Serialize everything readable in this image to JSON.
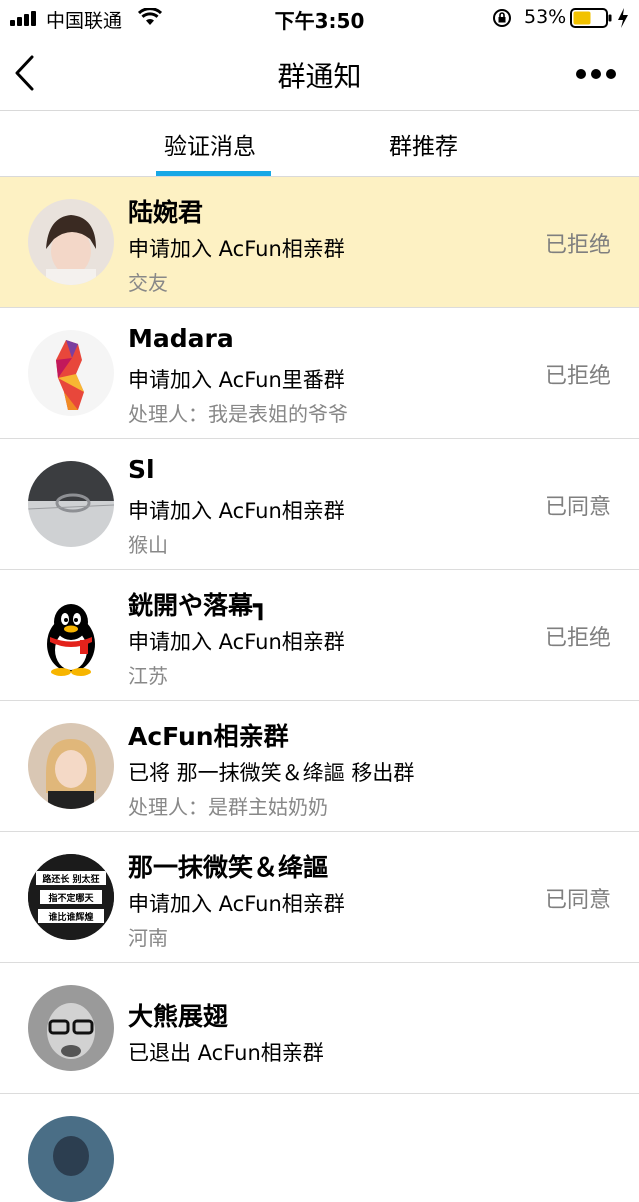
{
  "status_bar": {
    "carrier": "中国联通",
    "time": "下午3:50",
    "battery_percent": "53%"
  },
  "nav": {
    "title": "群通知",
    "back_icon": "chevron-left-icon",
    "more_icon": "more-dots-icon"
  },
  "tabs": [
    {
      "label": "验证消息",
      "active": true
    },
    {
      "label": "群推荐",
      "active": false
    }
  ],
  "accent_color": "#17a8e6",
  "highlight_color": "#fdf1c3",
  "notifications": [
    {
      "name": "陆婉君",
      "action": "申请加入 AcFun相亲群",
      "extra": "交友",
      "status": "已拒绝",
      "highlighted": true
    },
    {
      "name": "Madara",
      "action": "申请加入 AcFun里番群",
      "extra": "处理人：我是表姐的爷爷",
      "status": "已拒绝"
    },
    {
      "name": "Sl",
      "action": "申请加入 AcFun相亲群",
      "extra": "猴山",
      "status": "已同意"
    },
    {
      "name": "銧開や落幕┓",
      "action": "申请加入 AcFun相亲群",
      "extra": "江苏",
      "status": "已拒绝"
    },
    {
      "name": "AcFun相亲群",
      "action": "已将 那一抹微笑＆绛謳 移出群",
      "extra": "处理人：是群主姑奶奶",
      "status": ""
    },
    {
      "name": "那一抹微笑＆绛謳",
      "action": "申请加入 AcFun相亲群",
      "extra": "河南",
      "status": "已同意",
      "avatar_text": [
        "路还长 别太狂",
        "指不定哪天",
        "谁比谁辉煌"
      ]
    },
    {
      "name": "大熊展翅",
      "action": "已退出 AcFun相亲群",
      "extra": "",
      "status": ""
    }
  ]
}
